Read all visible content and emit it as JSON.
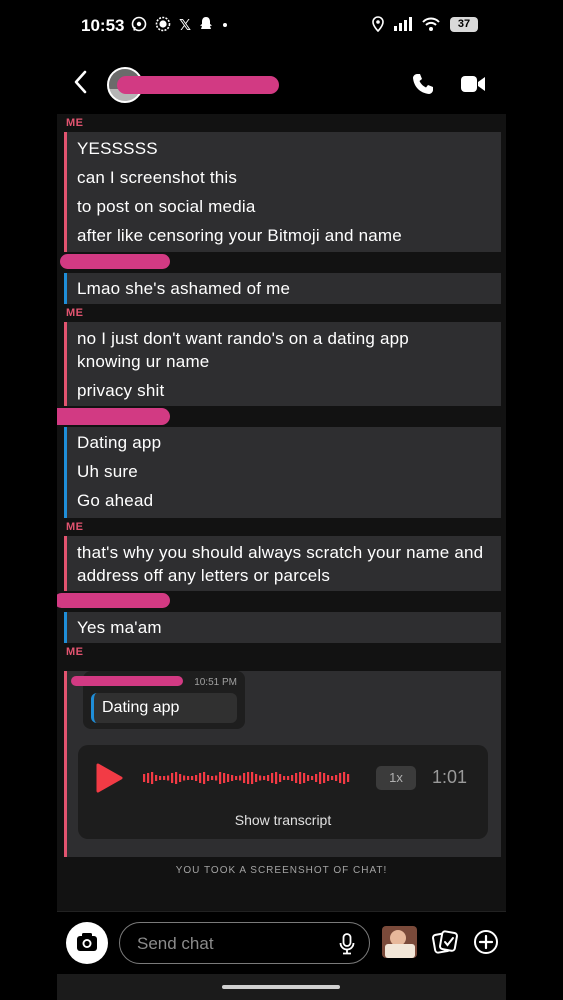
{
  "status_bar": {
    "time": "10:53",
    "battery": "37",
    "notification_icons": [
      "whatsapp-icon",
      "signal-icon",
      "x-icon",
      "snapchat-ghost-icon",
      "dot-icon"
    ],
    "system_icons": [
      "location-icon",
      "cellular-icon",
      "wifi-icon",
      "battery-icon"
    ]
  },
  "header": {
    "back_icon": "chevron-left-icon",
    "call_icon": "phone-icon",
    "video_icon": "video-camera-icon"
  },
  "colors": {
    "me": "#e25470",
    "them": "#1f8ed8",
    "redaction": "#d23a83",
    "bubble": "#2e2e30"
  },
  "messages": [
    {
      "sender": "ME",
      "lines": [
        "YESSSSS",
        "can I screenshot this",
        "to post on social media",
        "after like censoring your Bitmoji and name"
      ]
    },
    {
      "sender": "",
      "lines": [
        "Lmao she's ashamed of me"
      ]
    },
    {
      "sender": "ME",
      "lines": [
        "no I just don't want rando's on a dating app knowing ur name",
        "privacy shit"
      ]
    },
    {
      "sender": "",
      "lines": [
        "Dating app",
        "Uh sure",
        "Go ahead"
      ]
    },
    {
      "sender": "ME",
      "lines": [
        "that's why you should always scratch your name and address off any letters or parcels"
      ]
    },
    {
      "sender": "",
      "lines": [
        "Yes ma'am"
      ]
    },
    {
      "sender": "ME"
    }
  ],
  "reply": {
    "time": "10:51 PM",
    "quoted_text": "Dating app",
    "voice_note": {
      "speed": "1x",
      "duration": "1:01",
      "transcript_button": "Show transcript"
    }
  },
  "screenshot_notice": "YOU TOOK A SCREENSHOT OF CHAT!",
  "composer": {
    "placeholder": "Send chat",
    "camera_icon": "camera-icon",
    "mic_icon": "microphone-icon",
    "sticker_icon": "sticker-icon",
    "plus_icon": "plus-circle-icon"
  }
}
